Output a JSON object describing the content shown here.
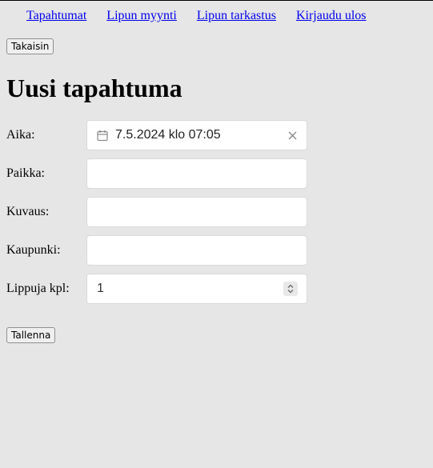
{
  "nav": {
    "items": [
      {
        "label": "Tapahtumat"
      },
      {
        "label": "Lipun myynti"
      },
      {
        "label": "Lipun tarkastus"
      },
      {
        "label": "Kirjaudu ulos"
      }
    ]
  },
  "back_button": {
    "label": "Takaisin"
  },
  "page_title": "Uusi tapahtuma",
  "form": {
    "time": {
      "label": "Aika:",
      "value": "7.5.2024 klo 07:05",
      "icon": "calendar-icon",
      "clear_icon": "close-icon"
    },
    "place": {
      "label": "Paikka:",
      "value": ""
    },
    "description": {
      "label": "Kuvaus:",
      "value": ""
    },
    "city": {
      "label": "Kaupunki:",
      "value": ""
    },
    "tickets": {
      "label": "Lippuja kpl:",
      "value": "1",
      "icon": "stepper-icon"
    }
  },
  "save_button": {
    "label": "Tallenna"
  }
}
